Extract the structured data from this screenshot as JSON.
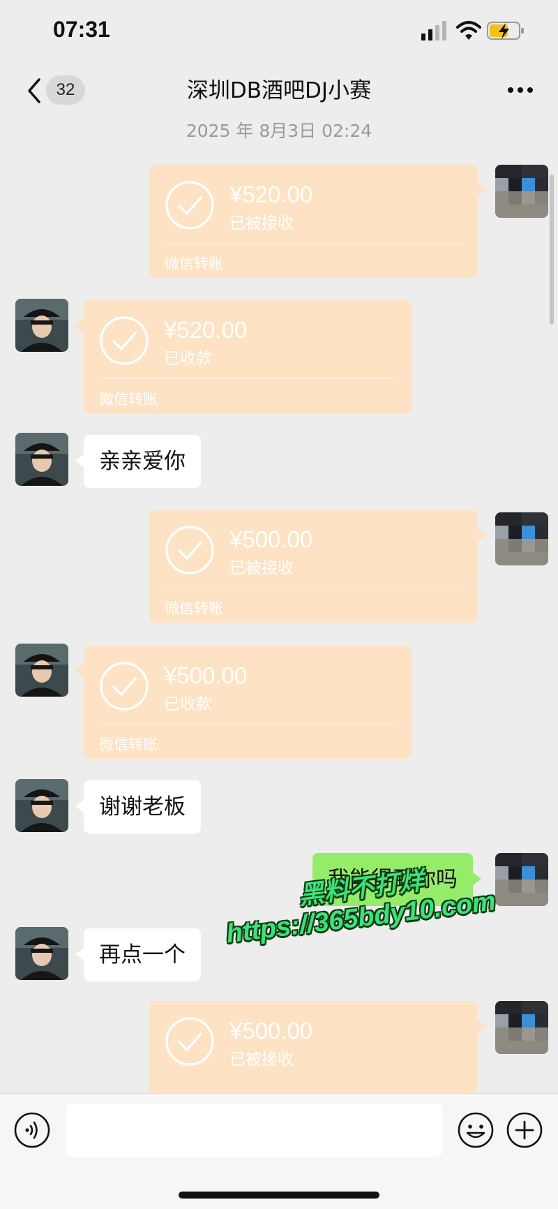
{
  "status_bar": {
    "time": "07:31",
    "icons": [
      "signal-icon",
      "wifi-icon",
      "battery-charging-icon"
    ]
  },
  "nav": {
    "unread_count": "32",
    "title": "深圳DB酒吧DJ小赛",
    "icons": [
      "back-chevron-icon",
      "more-dots-icon"
    ]
  },
  "timestamp": "2025 年 8月3日 02:24",
  "messages": [
    {
      "side": "right",
      "type": "transfer",
      "amount": "¥520.00",
      "status": "已被接收",
      "service": "微信转账"
    },
    {
      "side": "left",
      "type": "transfer",
      "amount": "¥520.00",
      "status": "已收款",
      "service": "微信转账"
    },
    {
      "side": "left",
      "type": "text",
      "text": "亲亲爱你"
    },
    {
      "side": "right",
      "type": "transfer",
      "amount": "¥500.00",
      "status": "已被接收",
      "service": "微信转账"
    },
    {
      "side": "left",
      "type": "transfer",
      "amount": "¥500.00",
      "status": "已收款",
      "service": "微信转账"
    },
    {
      "side": "left",
      "type": "text",
      "text": "谢谢老板"
    },
    {
      "side": "right",
      "type": "text",
      "text": "我能得到你吗"
    },
    {
      "side": "left",
      "type": "text",
      "text": "再点一个"
    },
    {
      "side": "right",
      "type": "transfer",
      "amount": "¥500.00",
      "status": "已被接收",
      "service": ""
    }
  ],
  "watermark": {
    "line1": "黑料不打烊",
    "line2": "https://365bdy10.com"
  },
  "input_bar": {
    "placeholder": "",
    "icons": [
      "voice-icon",
      "emoji-icon",
      "plus-icon"
    ]
  },
  "colors": {
    "background": "#ededed",
    "transfer_card": "#fde2c4",
    "sent_bubble": "#95ec69",
    "received_bubble": "#ffffff",
    "watermark": "#3fe07a"
  }
}
